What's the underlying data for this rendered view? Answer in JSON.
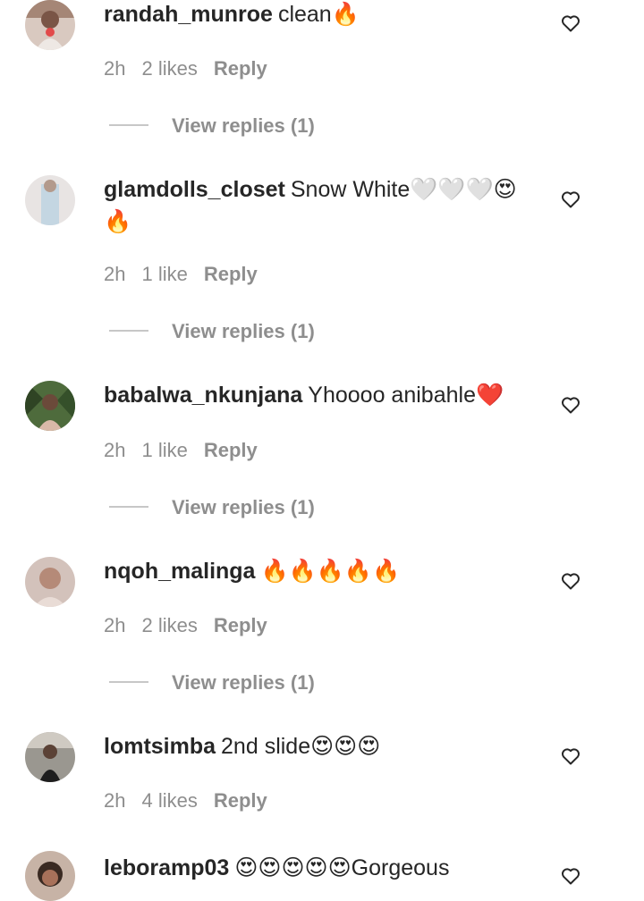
{
  "comments": [
    {
      "username": "randah_munroe",
      "text": "clean🔥",
      "time": "2h",
      "likes": "2 likes",
      "reply_label": "Reply",
      "view_replies": "View replies (1)",
      "avatar_color": "#8a6a5c"
    },
    {
      "username": "glamdolls_closet",
      "text": "Snow White🤍🤍🤍😍🔥",
      "time": "2h",
      "likes": "1 like",
      "reply_label": "Reply",
      "view_replies": "View replies (1)",
      "avatar_color": "#c9c3c2"
    },
    {
      "username": "babalwa_nkunjana",
      "text": "Yhoooo anibahle❤️",
      "time": "2h",
      "likes": "1 like",
      "reply_label": "Reply",
      "view_replies": "View replies (1)",
      "avatar_color": "#3f5a32"
    },
    {
      "username": "nqoh_malinga",
      "text": "🔥🔥🔥🔥🔥",
      "time": "2h",
      "likes": "2 likes",
      "reply_label": "Reply",
      "view_replies": "View replies (1)",
      "avatar_color": "#b8988a"
    },
    {
      "username": "lomtsimba",
      "text": "2nd slide😍😍😍",
      "time": "2h",
      "likes": "4 likes",
      "reply_label": "Reply",
      "view_replies": "",
      "avatar_color": "#6d6d68"
    },
    {
      "username": "leboramp03",
      "text": "😍😍😍😍😍Gorgeous",
      "time": "",
      "likes": "",
      "reply_label": "",
      "view_replies": "",
      "avatar_color": "#5a4438"
    }
  ],
  "colors": {
    "text": "#262626",
    "muted": "#8e8e8e",
    "divider": "#c7c7c7"
  },
  "icons": {
    "like": "heart-outline-icon"
  }
}
